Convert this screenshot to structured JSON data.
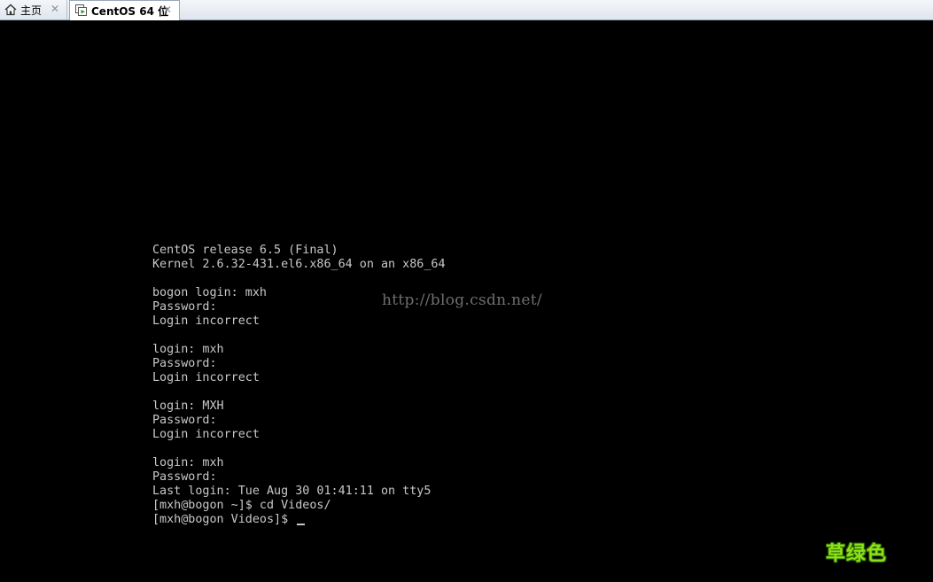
{
  "tabs": [
    {
      "label": "主页",
      "icon": "home-icon",
      "active": false
    },
    {
      "label": "CentOS 64 位",
      "icon": "vm-icon",
      "active": true
    }
  ],
  "console": {
    "lines": [
      "CentOS release 6.5 (Final)",
      "Kernel 2.6.32-431.el6.x86_64 on an x86_64",
      "",
      "bogon login: mxh",
      "Password:",
      "Login incorrect",
      "",
      "login: mxh",
      "Password:",
      "Login incorrect",
      "",
      "login: MXH",
      "Password:",
      "Login incorrect",
      "",
      "login: mxh",
      "Password:",
      "Last login: Tue Aug 30 01:41:11 on tty5",
      "[mxh@bogon ~]$ cd Videos/",
      "[mxh@bogon Videos]$ "
    ],
    "text_color": "#c8c8c8",
    "background": "#000000"
  },
  "watermarks": {
    "url": "http://blog.csdn.net/",
    "brand": "草绿色"
  }
}
